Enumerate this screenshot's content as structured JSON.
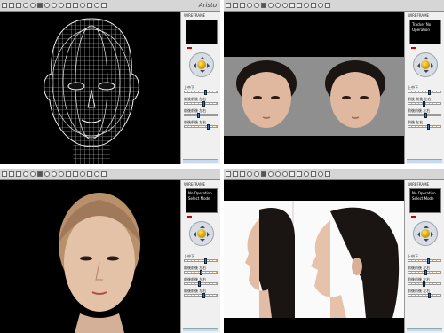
{
  "app": {
    "logo_text": "Aristo"
  },
  "panels": {
    "q1": {
      "title": "WIREFRAME",
      "preview_lines": [
        "",
        ""
      ],
      "sliders": [
        {
          "label": "上中下",
          "value": 0.62
        },
        {
          "label": "前後前後 左右",
          "value": 0.55
        },
        {
          "label": "前後前後 左右",
          "value": 0.4
        },
        {
          "label": "前後前後 左右",
          "value": 0.7
        }
      ]
    },
    "q2": {
      "title": "WIREFRAME",
      "preview_lines": [
        "Tracker No Operation",
        ""
      ],
      "sliders": [
        {
          "label": "上中下",
          "value": 0.6
        },
        {
          "label": "前後 前後 左右",
          "value": 0.45
        },
        {
          "label": "前後前後 左右",
          "value": 0.5
        },
        {
          "label": "前後 左右",
          "value": 0.58
        }
      ]
    },
    "q3": {
      "title": "WIREFRAME",
      "preview_lines": [
        "No Operation",
        "Select Mode"
      ],
      "sliders": [
        {
          "label": "上中下",
          "value": 0.6
        },
        {
          "label": "前後前後 左右",
          "value": 0.48
        },
        {
          "label": "前後前後 左右",
          "value": 0.42
        },
        {
          "label": "前後前後 左右",
          "value": 0.55
        }
      ]
    },
    "q4": {
      "title": "WIREFRAME",
      "preview_lines": [
        "No Operation",
        "Select Mode"
      ],
      "sliders": [
        {
          "label": "上中下",
          "value": 0.58
        },
        {
          "label": "前後前後 左右",
          "value": 0.5
        },
        {
          "label": "前後前後 左右",
          "value": 0.44
        },
        {
          "label": "前後前後 左右",
          "value": 0.62
        }
      ]
    }
  },
  "colors": {
    "viewport_bg": "#000000",
    "panel_bg": "#f0f0f0",
    "accent": "#3a6fd0",
    "status_red": "#cc0000"
  }
}
